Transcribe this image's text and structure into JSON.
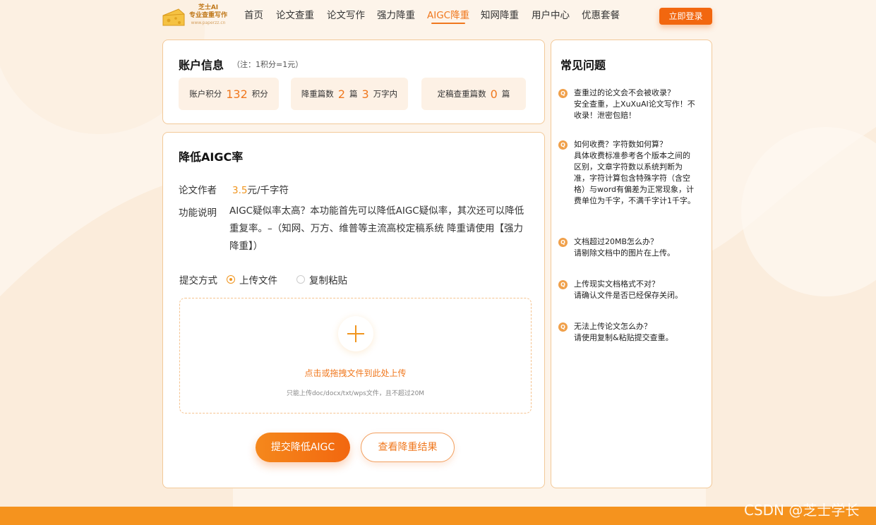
{
  "brand": {
    "name": "芝士AI",
    "slogan": "专业查重写作",
    "url": "www.paperzz.cn"
  },
  "nav": {
    "items": [
      {
        "label": "首页"
      },
      {
        "label": "论文查重"
      },
      {
        "label": "论文写作"
      },
      {
        "label": "强力降重"
      },
      {
        "label": "AIGC降重",
        "active": true
      },
      {
        "label": "知网降重"
      },
      {
        "label": "用户中心"
      },
      {
        "label": "优惠套餐"
      }
    ],
    "login_label": "立即登录"
  },
  "account": {
    "title": "账户信息",
    "note": "（注：1积分=1元）",
    "stats": [
      {
        "label": "账户积分",
        "parts": [
          {
            "num": "132",
            "unit": "积分"
          }
        ]
      },
      {
        "label": "降重篇数",
        "parts": [
          {
            "num": "2",
            "unit": "篇"
          },
          {
            "num": "3",
            "unit": "万字内"
          }
        ]
      },
      {
        "label": "定稿查重篇数",
        "parts": [
          {
            "num": "0",
            "unit": "篇"
          }
        ]
      }
    ]
  },
  "aigc": {
    "title": "降低AIGC率",
    "author_label": "论文作者",
    "price_num": "3.5",
    "price_unit": "元/千字符",
    "desc_label": "功能说明",
    "desc_text": "AIGC疑似率太高？本功能首先可以降低AIGC疑似率，其次还可以降低重复率。–（知网、万方、维普等主流高校定稿系统 降重请使用【强力降重】）",
    "submit_label": "提交方式",
    "options": [
      {
        "label": "上传文件",
        "selected": true
      },
      {
        "label": "复制粘贴",
        "selected": false
      }
    ],
    "upload_main": "点击或拖拽文件到此处上传",
    "upload_hint": "只能上传doc/docx/txt/wps文件，且不超过20M",
    "submit_button": "提交降低AIGC",
    "results_button": "查看降重结果"
  },
  "faq": {
    "title": "常见问题",
    "icon_letter": "Q",
    "items": [
      {
        "q": "查重过的论文会不会被收录？",
        "a": "安全查重，上XuXuAI论文写作！不收录！泄密包赔！"
      },
      {
        "q": "如何收费？字符数如何算？",
        "a": "具体收费标准参考各个版本之间的区别，文章字符数以系统判断为准，字符计算包含特殊字符（含空格）与word有偏差为正常现象，计费单位为千字，不满千字计1千字。"
      },
      {
        "q": "文档超过20MB怎么办？",
        "a": "请剔除文档中的图片在上传。"
      },
      {
        "q": "上传现实文档格式不对？",
        "a": "请确认文件是否已经保存关闭。"
      },
      {
        "q": "无法上传论文怎么办？",
        "a": "请使用复制&粘贴提交查重。"
      }
    ]
  },
  "watermark": "CSDN @芝士学长",
  "colors": {
    "accent": "#f0781e",
    "accent_light": "#f0951e",
    "background": "#fdf4ea",
    "card_border": "#f2c999",
    "bottom_bar": "#f5931e"
  }
}
